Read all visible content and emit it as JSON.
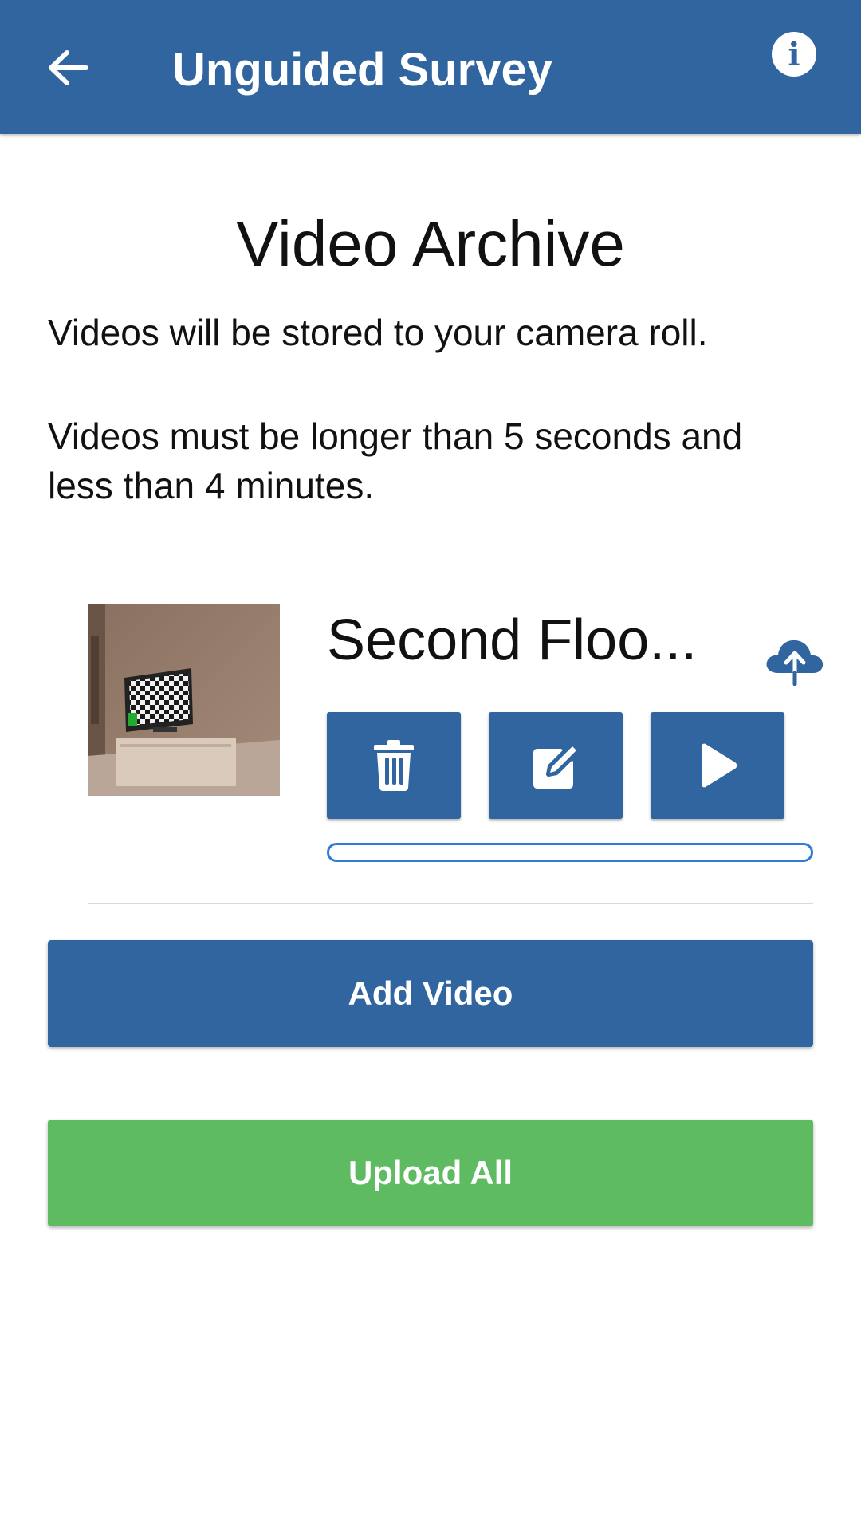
{
  "app_bar": {
    "title": "Unguided Survey",
    "back_icon": "arrow-left-icon",
    "info_icon": "info-icon",
    "info_glyph": "i",
    "color": "#30659f"
  },
  "main": {
    "title": "Video Archive",
    "description_1": "Videos will be stored to your camera roll.",
    "description_2": "Videos must be longer than 5 seconds and less than 4 minutes."
  },
  "videos": [
    {
      "name": "Second Floo...",
      "upload_progress": 0,
      "actions": [
        "trash-icon",
        "edit-icon",
        "play-icon"
      ],
      "upload_icon": "cloud-upload-icon"
    }
  ],
  "buttons": {
    "add_video": "Add Video",
    "upload_all": "Upload All"
  },
  "colors": {
    "primary": "#30659f",
    "success": "#5fbb62",
    "progress_border": "#2f7bd8"
  }
}
